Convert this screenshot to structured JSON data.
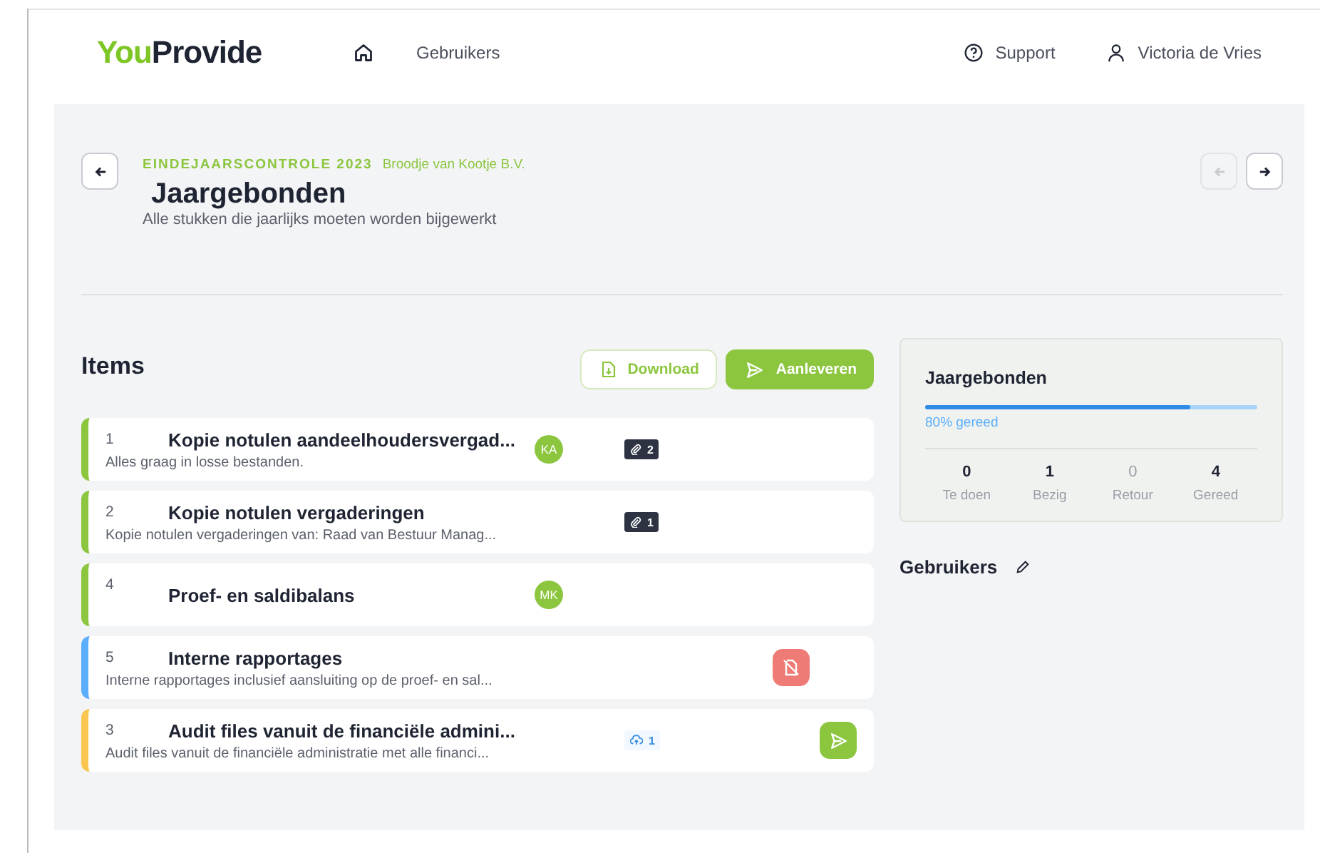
{
  "header": {
    "logo": [
      {
        "text": "You",
        "accent": true
      },
      {
        "text": "Provide",
        "accent": false
      }
    ],
    "nav": [
      {
        "label": "Gebruikers"
      }
    ],
    "support": "Support",
    "user": "Victoria de Vries"
  },
  "page": {
    "eyebrow": "EINDEJAARSCONTROLE 2023",
    "client": "Broodje van Kootje B.V.",
    "title": "Jaargebonden",
    "subtitle": "Alle stukken die jaarlijks moeten worden bijgewerkt",
    "prev_disabled": true,
    "next_disabled": false
  },
  "items": {
    "title": "Items",
    "download": "Download",
    "submit": "Aanleveren",
    "rows": [
      {
        "number": "1",
        "title": "Kopie notulen aandeelhoudersvergad...",
        "description": "Alles graag in losse bestanden.",
        "color": "#8cc63f",
        "avatar": "KA",
        "badge": {
          "kind": "attachment",
          "count": "2"
        }
      },
      {
        "number": "2",
        "title": "Kopie notulen vergaderingen",
        "description": "Kopie notulen vergaderingen van: Raad van Bestuur Manag...",
        "color": "#8cc63f",
        "badge": {
          "kind": "attachment",
          "count": "1"
        }
      },
      {
        "number": "4",
        "title": "Proef- en saldibalans",
        "color": "#8cc63f",
        "avatar": "MK"
      },
      {
        "number": "5",
        "title": "Interne rapportages",
        "description": "Interne rapportages inclusief aansluiting op de proef- en sal...",
        "color": "#5aaefc",
        "action": {
          "kind": "no-file"
        }
      },
      {
        "number": "3",
        "title": "Audit files vanuit de financiële admini...",
        "description": "Audit files vanuit de financiële administratie met alle financi...",
        "color": "#f9c74f",
        "badge": {
          "kind": "upload",
          "count": "1"
        },
        "action": {
          "kind": "send"
        }
      }
    ]
  },
  "summary": {
    "title": "Jaargebonden",
    "level": 0.8,
    "progress_label": "80% gereed",
    "stats": [
      {
        "value": "0",
        "label": "Te doen",
        "muted": false
      },
      {
        "value": "1",
        "label": "Bezig",
        "muted": false
      },
      {
        "value": "0",
        "label": "Retour",
        "muted": true
      },
      {
        "value": "4",
        "label": "Gereed",
        "muted": false
      }
    ]
  },
  "users": {
    "title": "Gebruikers"
  }
}
